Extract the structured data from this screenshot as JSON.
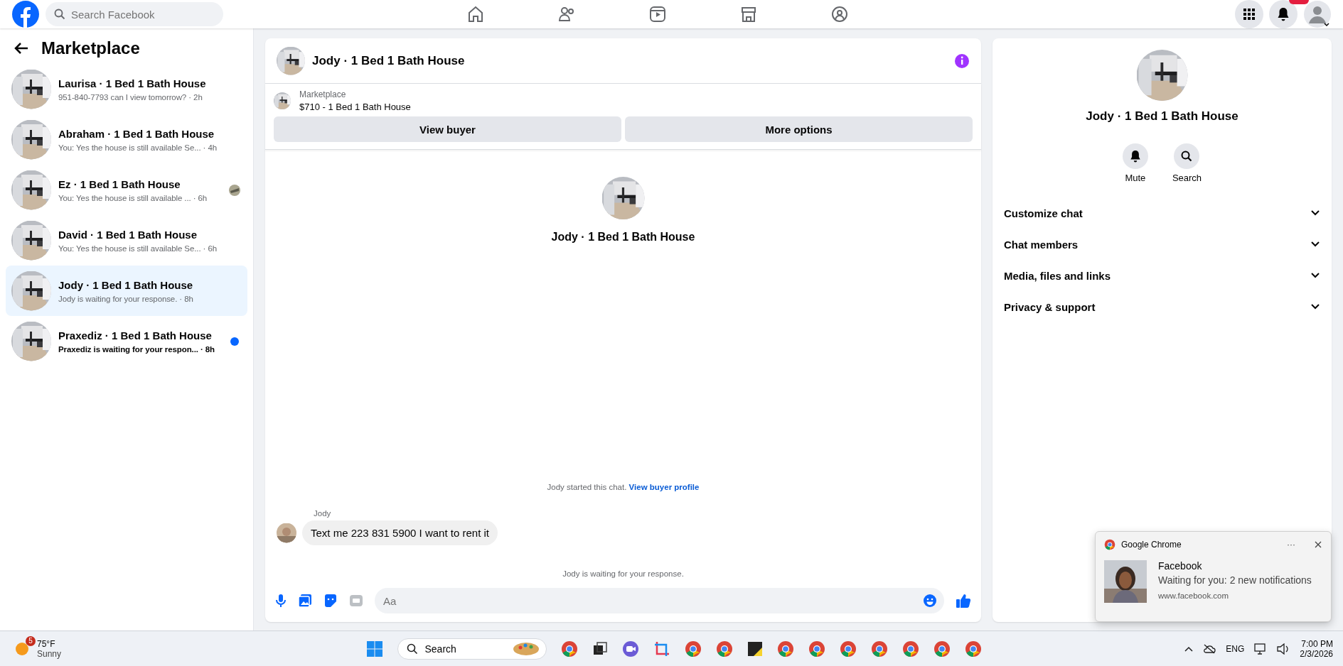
{
  "top_bar": {
    "search": {
      "placeholder": "Search Facebook"
    }
  },
  "sidebar": {
    "title": "Marketplace",
    "conversations": [
      {
        "name": "Laurisa · 1 Bed 1 Bath House",
        "preview": "951-840-7793 can I view tomorrow? · 2h",
        "selected": false,
        "unread": false,
        "seen_avatar": false
      },
      {
        "name": "Abraham · 1 Bed 1 Bath House",
        "preview": "You: Yes the house is still available Se...  · 4h",
        "selected": false,
        "unread": false,
        "seen_avatar": false
      },
      {
        "name": "Ez · 1 Bed 1 Bath House",
        "preview": "You: Yes the house is still available ...  · 6h",
        "selected": false,
        "unread": false,
        "seen_avatar": true
      },
      {
        "name": "David · 1 Bed 1 Bath House",
        "preview": "You: Yes the house is still available Se...  · 6h",
        "selected": false,
        "unread": false,
        "seen_avatar": false
      },
      {
        "name": "Jody · 1 Bed 1 Bath House",
        "preview": "Jody is waiting for your response. · 8h",
        "selected": true,
        "unread": false,
        "seen_avatar": false
      },
      {
        "name": "Praxediz · 1 Bed 1 Bath House",
        "preview": "Praxediz is waiting for your respon... · 8h",
        "selected": false,
        "unread": true,
        "seen_avatar": false
      }
    ]
  },
  "chat": {
    "title": "Jody · 1 Bed 1 Bath House",
    "listing": {
      "label": "Marketplace",
      "item": "$710 - 1 Bed 1 Bath House"
    },
    "buttons": [
      "View buyer",
      "More options"
    ],
    "intro_title": "Jody · 1 Bed 1 Bath House",
    "started": "Jody started this chat.",
    "profile_link": "View buyer profile",
    "sender": "Jody",
    "message": "Text me 223 831 5900 I want to rent it",
    "status": "Jody is waiting for your response.",
    "composer": {
      "placeholder": "Aa"
    }
  },
  "details": {
    "title": "Jody · 1 Bed 1 Bath House",
    "actions": [
      {
        "kind": "bell",
        "label": "Mute"
      },
      {
        "kind": "search",
        "label": "Search"
      }
    ],
    "sections": [
      {
        "label": "Customize chat",
        "expanded": false
      },
      {
        "label": "Chat members",
        "expanded": false
      },
      {
        "label": "Media, files and links",
        "expanded": false
      },
      {
        "label": "Privacy & support",
        "expanded": false
      }
    ]
  },
  "notification": {
    "app": "Google Chrome",
    "more": "···",
    "title": "Facebook",
    "body": "Waiting for you: 2 new notifications",
    "url": "www.facebook.com"
  },
  "taskbar": {
    "weather_badge": "5",
    "temperature": "75°F",
    "condition": "Sunny",
    "search": "Search",
    "language": "ENG",
    "time": "7:00 PM",
    "date": "2/3/2026"
  }
}
